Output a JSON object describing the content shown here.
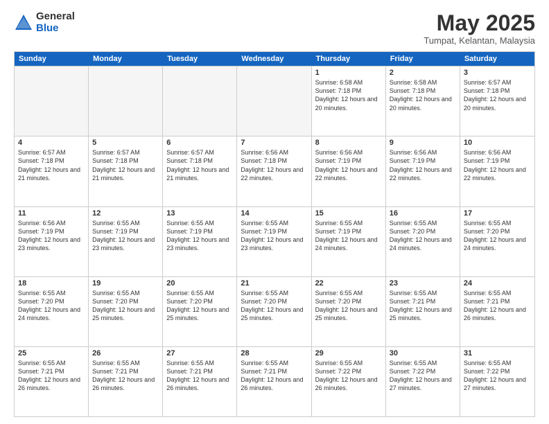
{
  "logo": {
    "general": "General",
    "blue": "Blue"
  },
  "header": {
    "month": "May 2025",
    "location": "Tumpat, Kelantan, Malaysia"
  },
  "days": [
    "Sunday",
    "Monday",
    "Tuesday",
    "Wednesday",
    "Thursday",
    "Friday",
    "Saturday"
  ],
  "weeks": [
    [
      {
        "day": "",
        "empty": true
      },
      {
        "day": "",
        "empty": true
      },
      {
        "day": "",
        "empty": true
      },
      {
        "day": "",
        "empty": true
      },
      {
        "day": "1",
        "sunrise": "Sunrise: 6:58 AM",
        "sunset": "Sunset: 7:18 PM",
        "daylight": "Daylight: 12 hours and 20 minutes."
      },
      {
        "day": "2",
        "sunrise": "Sunrise: 6:58 AM",
        "sunset": "Sunset: 7:18 PM",
        "daylight": "Daylight: 12 hours and 20 minutes."
      },
      {
        "day": "3",
        "sunrise": "Sunrise: 6:57 AM",
        "sunset": "Sunset: 7:18 PM",
        "daylight": "Daylight: 12 hours and 20 minutes."
      }
    ],
    [
      {
        "day": "4",
        "sunrise": "Sunrise: 6:57 AM",
        "sunset": "Sunset: 7:18 PM",
        "daylight": "Daylight: 12 hours and 21 minutes."
      },
      {
        "day": "5",
        "sunrise": "Sunrise: 6:57 AM",
        "sunset": "Sunset: 7:18 PM",
        "daylight": "Daylight: 12 hours and 21 minutes."
      },
      {
        "day": "6",
        "sunrise": "Sunrise: 6:57 AM",
        "sunset": "Sunset: 7:18 PM",
        "daylight": "Daylight: 12 hours and 21 minutes."
      },
      {
        "day": "7",
        "sunrise": "Sunrise: 6:56 AM",
        "sunset": "Sunset: 7:18 PM",
        "daylight": "Daylight: 12 hours and 22 minutes."
      },
      {
        "day": "8",
        "sunrise": "Sunrise: 6:56 AM",
        "sunset": "Sunset: 7:19 PM",
        "daylight": "Daylight: 12 hours and 22 minutes."
      },
      {
        "day": "9",
        "sunrise": "Sunrise: 6:56 AM",
        "sunset": "Sunset: 7:19 PM",
        "daylight": "Daylight: 12 hours and 22 minutes."
      },
      {
        "day": "10",
        "sunrise": "Sunrise: 6:56 AM",
        "sunset": "Sunset: 7:19 PM",
        "daylight": "Daylight: 12 hours and 22 minutes."
      }
    ],
    [
      {
        "day": "11",
        "sunrise": "Sunrise: 6:56 AM",
        "sunset": "Sunset: 7:19 PM",
        "daylight": "Daylight: 12 hours and 23 minutes."
      },
      {
        "day": "12",
        "sunrise": "Sunrise: 6:55 AM",
        "sunset": "Sunset: 7:19 PM",
        "daylight": "Daylight: 12 hours and 23 minutes."
      },
      {
        "day": "13",
        "sunrise": "Sunrise: 6:55 AM",
        "sunset": "Sunset: 7:19 PM",
        "daylight": "Daylight: 12 hours and 23 minutes."
      },
      {
        "day": "14",
        "sunrise": "Sunrise: 6:55 AM",
        "sunset": "Sunset: 7:19 PM",
        "daylight": "Daylight: 12 hours and 23 minutes."
      },
      {
        "day": "15",
        "sunrise": "Sunrise: 6:55 AM",
        "sunset": "Sunset: 7:19 PM",
        "daylight": "Daylight: 12 hours and 24 minutes."
      },
      {
        "day": "16",
        "sunrise": "Sunrise: 6:55 AM",
        "sunset": "Sunset: 7:20 PM",
        "daylight": "Daylight: 12 hours and 24 minutes."
      },
      {
        "day": "17",
        "sunrise": "Sunrise: 6:55 AM",
        "sunset": "Sunset: 7:20 PM",
        "daylight": "Daylight: 12 hours and 24 minutes."
      }
    ],
    [
      {
        "day": "18",
        "sunrise": "Sunrise: 6:55 AM",
        "sunset": "Sunset: 7:20 PM",
        "daylight": "Daylight: 12 hours and 24 minutes."
      },
      {
        "day": "19",
        "sunrise": "Sunrise: 6:55 AM",
        "sunset": "Sunset: 7:20 PM",
        "daylight": "Daylight: 12 hours and 25 minutes."
      },
      {
        "day": "20",
        "sunrise": "Sunrise: 6:55 AM",
        "sunset": "Sunset: 7:20 PM",
        "daylight": "Daylight: 12 hours and 25 minutes."
      },
      {
        "day": "21",
        "sunrise": "Sunrise: 6:55 AM",
        "sunset": "Sunset: 7:20 PM",
        "daylight": "Daylight: 12 hours and 25 minutes."
      },
      {
        "day": "22",
        "sunrise": "Sunrise: 6:55 AM",
        "sunset": "Sunset: 7:20 PM",
        "daylight": "Daylight: 12 hours and 25 minutes."
      },
      {
        "day": "23",
        "sunrise": "Sunrise: 6:55 AM",
        "sunset": "Sunset: 7:21 PM",
        "daylight": "Daylight: 12 hours and 25 minutes."
      },
      {
        "day": "24",
        "sunrise": "Sunrise: 6:55 AM",
        "sunset": "Sunset: 7:21 PM",
        "daylight": "Daylight: 12 hours and 26 minutes."
      }
    ],
    [
      {
        "day": "25",
        "sunrise": "Sunrise: 6:55 AM",
        "sunset": "Sunset: 7:21 PM",
        "daylight": "Daylight: 12 hours and 26 minutes."
      },
      {
        "day": "26",
        "sunrise": "Sunrise: 6:55 AM",
        "sunset": "Sunset: 7:21 PM",
        "daylight": "Daylight: 12 hours and 26 minutes."
      },
      {
        "day": "27",
        "sunrise": "Sunrise: 6:55 AM",
        "sunset": "Sunset: 7:21 PM",
        "daylight": "Daylight: 12 hours and 26 minutes."
      },
      {
        "day": "28",
        "sunrise": "Sunrise: 6:55 AM",
        "sunset": "Sunset: 7:21 PM",
        "daylight": "Daylight: 12 hours and 26 minutes."
      },
      {
        "day": "29",
        "sunrise": "Sunrise: 6:55 AM",
        "sunset": "Sunset: 7:22 PM",
        "daylight": "Daylight: 12 hours and 26 minutes."
      },
      {
        "day": "30",
        "sunrise": "Sunrise: 6:55 AM",
        "sunset": "Sunset: 7:22 PM",
        "daylight": "Daylight: 12 hours and 27 minutes."
      },
      {
        "day": "31",
        "sunrise": "Sunrise: 6:55 AM",
        "sunset": "Sunset: 7:22 PM",
        "daylight": "Daylight: 12 hours and 27 minutes."
      }
    ]
  ]
}
